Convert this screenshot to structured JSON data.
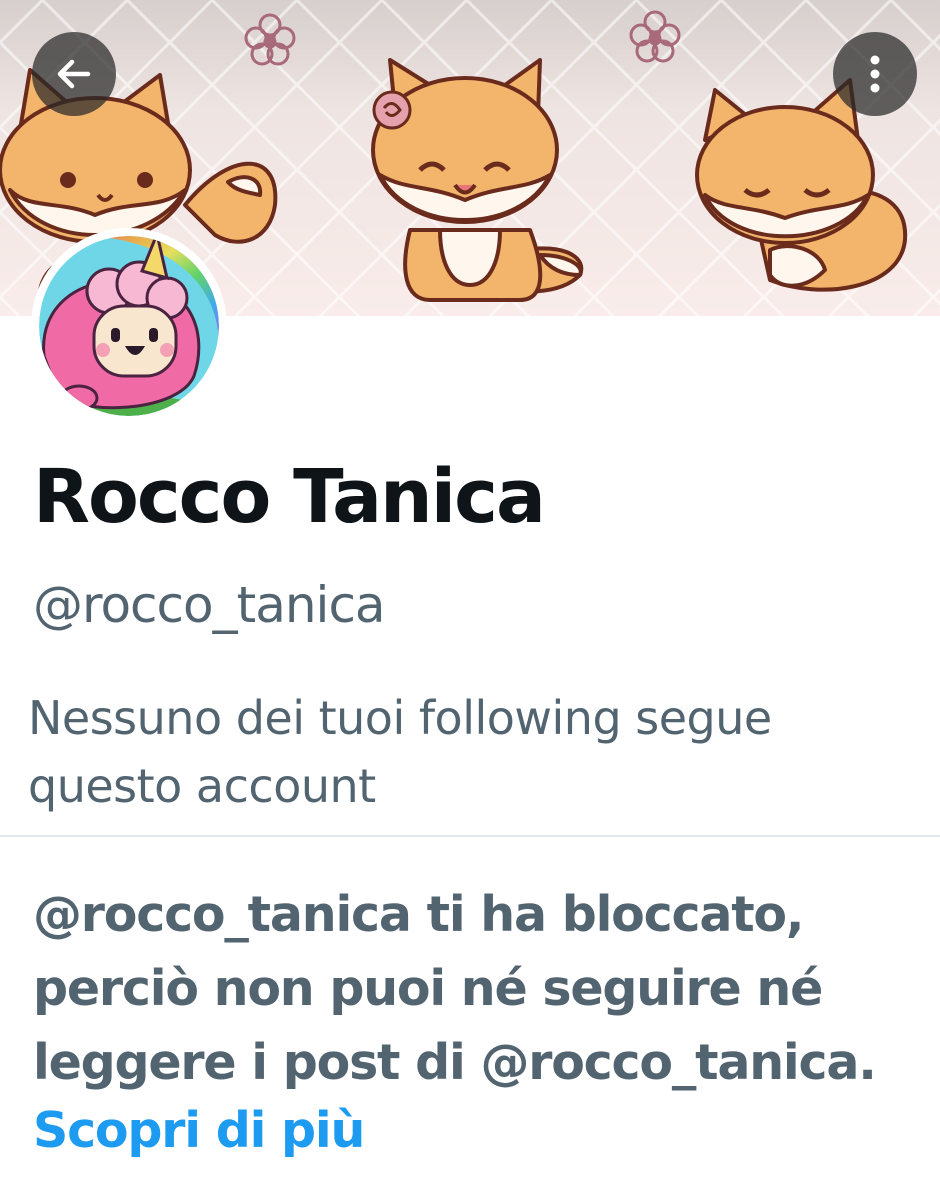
{
  "header": {
    "back_icon": "arrow-left-icon",
    "more_icon": "more-vertical-icon"
  },
  "profile": {
    "display_name": "Rocco Tanica",
    "handle": "@rocco_tanica",
    "followers_note": "Nessuno dei tuoi following segue questo account"
  },
  "blocked": {
    "message": "@rocco_tanica ti ha bloccato, perciò non puoi né seguire né leggere i post di @rocco_tanica.",
    "learn_more": "Scopri di più"
  },
  "colors": {
    "name": "#0f1419",
    "secondary": "#536471",
    "link": "#1d9bf0",
    "divider": "#e6e9eb"
  }
}
